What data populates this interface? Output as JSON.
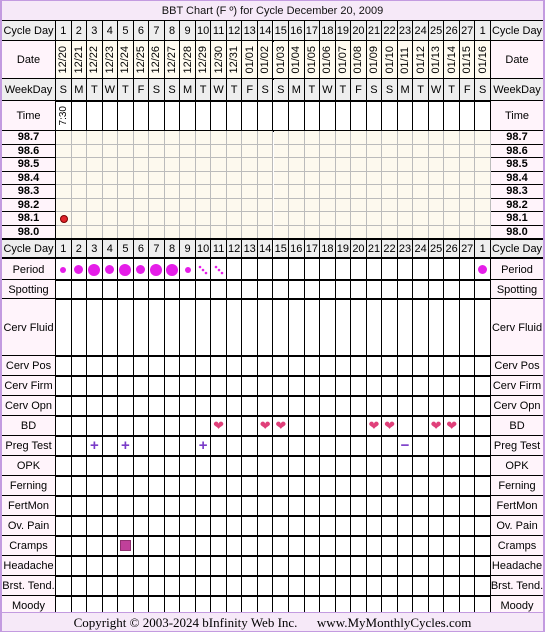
{
  "title": "BBT Chart (F º) for Cycle December 20, 2009",
  "labels": {
    "cycle_day": "Cycle Day",
    "date": "Date",
    "weekday": "WeekDay",
    "time": "Time",
    "period": "Period",
    "spotting": "Spotting",
    "cerv_fluid": "Cerv Fluid",
    "cerv_pos": "Cerv Pos",
    "cerv_firm": "Cerv Firm",
    "cerv_opn": "Cerv Opn",
    "bd": "BD",
    "preg_test": "Preg Test",
    "opk": "OPK",
    "ferning": "Ferning",
    "fertmon": "FertMon",
    "ov_pain": "Ov. Pain",
    "cramps": "Cramps",
    "headache": "Headache",
    "brst_tend": "Brst. Tend.",
    "moody": "Moody"
  },
  "footer": {
    "copyright": "Copyright © 2003-2024 bInfinity Web Inc.",
    "site": "www.MyMonthlyCycles.com"
  },
  "colors": {
    "period": "#e51ee8",
    "heart": "#e0407a",
    "preg_test": "#7a3cc8",
    "cramps": "#c0409a",
    "temp_point": "#e0242a",
    "border": "#c39be0"
  },
  "chart_data": {
    "type": "table",
    "title": "BBT Chart (F º) for Cycle December 20, 2009",
    "temperature_axis": [
      "98.7",
      "98.6",
      "98.5",
      "98.4",
      "98.3",
      "98.2",
      "98.1",
      "98.0"
    ],
    "ylim": [
      98.0,
      98.7
    ],
    "cycle_days": [
      "1",
      "2",
      "3",
      "4",
      "5",
      "6",
      "7",
      "8",
      "9",
      "10",
      "11",
      "12",
      "13",
      "14",
      "15",
      "16",
      "17",
      "18",
      "19",
      "20",
      "21",
      "22",
      "23",
      "24",
      "25",
      "26",
      "27",
      "1"
    ],
    "dates": [
      "12/20",
      "12/21",
      "12/22",
      "12/23",
      "12/24",
      "12/25",
      "12/26",
      "12/27",
      "12/28",
      "12/29",
      "12/30",
      "12/31",
      "01/01",
      "01/02",
      "01/03",
      "01/04",
      "01/05",
      "01/06",
      "01/07",
      "01/08",
      "01/09",
      "01/10",
      "01/11",
      "01/12",
      "01/13",
      "01/14",
      "01/15",
      "01/16"
    ],
    "weekdays": [
      "S",
      "M",
      "T",
      "W",
      "T",
      "F",
      "S",
      "S",
      "M",
      "T",
      "W",
      "T",
      "F",
      "S",
      "S",
      "M",
      "T",
      "W",
      "T",
      "F",
      "S",
      "S",
      "M",
      "T",
      "W",
      "T",
      "F",
      "S"
    ],
    "times": [
      "7:30",
      "",
      "",
      "",
      "",
      "",
      "",
      "",
      "",
      "",
      "",
      "",
      "",
      "",
      "",
      "",
      "",
      "",
      "",
      "",
      "",
      "",
      "",
      "",
      "",
      "",
      "",
      ""
    ],
    "temperatures": [
      98.1,
      null,
      null,
      null,
      null,
      null,
      null,
      null,
      null,
      null,
      null,
      null,
      null,
      null,
      null,
      null,
      null,
      null,
      null,
      null,
      null,
      null,
      null,
      null,
      null,
      null,
      null,
      null
    ],
    "period": [
      "light",
      "medium",
      "heavy",
      "medium",
      "heavy",
      "medium",
      "heavy",
      "heavy",
      "light",
      "spotting",
      "spotting",
      "",
      "",
      "",
      "",
      "",
      "",
      "",
      "",
      "",
      "",
      "",
      "",
      "",
      "",
      "",
      "",
      "medium"
    ],
    "bd_days": [
      11,
      14,
      15,
      21,
      22,
      25,
      26
    ],
    "preg_test": {
      "3": "+",
      "5": "+",
      "10": "+",
      "23": "−"
    },
    "cramps_days": [
      5
    ]
  }
}
